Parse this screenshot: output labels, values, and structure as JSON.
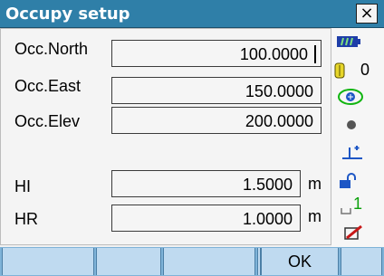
{
  "window": {
    "title": "Occupy setup",
    "close_label": "×"
  },
  "fields": [
    {
      "label": "Occ.North",
      "value": "100.0000",
      "unit": ""
    },
    {
      "label": "Occ.East",
      "value": "150.0000",
      "unit": ""
    },
    {
      "label": "Occ.Elev",
      "value": "200.0000",
      "unit": ""
    },
    {
      "label": "HI",
      "value": "1.5000",
      "unit": "m"
    },
    {
      "label": "HR",
      "value": "1.0000",
      "unit": "m"
    }
  ],
  "status": {
    "battery_icon": "battery-icon",
    "prism_constant": "0",
    "prism_icon": "prism-icon",
    "tilt_icon": "tilt-compensation-icon",
    "target_icon": "target-icon",
    "ground_icon": "station-icon",
    "lock_icon": "unlock-icon",
    "input_mode": "1",
    "input_icon": "input-mode-icon",
    "edit_icon": "edit-icon"
  },
  "softkeys": [
    "",
    "",
    "",
    "",
    "OK",
    ""
  ],
  "colors": {
    "title_bar": "#2f7fa8",
    "softkey_bar": "#7fb3d8",
    "softkey": "#bfdaf0"
  }
}
